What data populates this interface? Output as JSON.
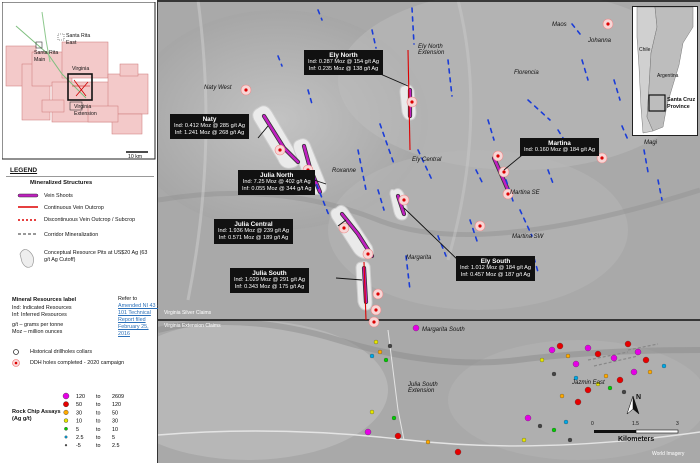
{
  "title": "",
  "locator_map": {
    "labels": [
      "Santa Rita East",
      "Santa Rita Main",
      "Virginia",
      "Virginia Extension"
    ],
    "scale_label": "10 km"
  },
  "legend": {
    "heading": "LEGEND",
    "structures_heading": "Mineralized Structures",
    "items": [
      "Vein Shoots",
      "Continuous Vein Outcrop",
      "Discontinuous Vein Outcrop / Subcrop",
      "Corridor Mineralization"
    ],
    "pit_label": "Conceptual Resource Pits at US$20 Ag (63 g/t Ag Cutoff)",
    "resources_heading": "Mineral Resources label",
    "resources_lines": [
      "Ind: Indicated Resources",
      "Inf: Inferred Resources",
      "g/t – grams per tonne",
      "Moz – million ounces"
    ],
    "refer_lines": [
      "Refer to",
      "Amended NI 43 -",
      "101 Technical",
      "Report filed",
      "February 25,",
      "2016"
    ],
    "drill_items": [
      "Historical drillholes collars",
      "DDH holes completed - 2020 campaign"
    ],
    "rock_chip_heading": "Rock Chip Assays (Ag g/t)",
    "rock_chip_bins": [
      {
        "from": "120",
        "to": "2609",
        "color": "#e600e6"
      },
      {
        "from": "50",
        "to": "120",
        "color": "#e60000"
      },
      {
        "from": "30",
        "to": "50",
        "color": "#ffaa00"
      },
      {
        "from": "10",
        "to": "30",
        "color": "#e6e600"
      },
      {
        "from": "5",
        "to": "10",
        "color": "#00cc00"
      },
      {
        "from": "2.5",
        "to": "5",
        "color": "#00a8e6"
      },
      {
        "from": "-5",
        "to": "2.5",
        "color": "#444444"
      }
    ]
  },
  "deposits": [
    {
      "name": "Ely North",
      "ind": "Ind: 0.287 Moz @ 154 g/t Ag",
      "inf": "Inf: 0.235 Moz @ 138 g/t Ag"
    },
    {
      "name": "Naty",
      "ind": "Ind: 0.412 Moz @ 285 g/t Ag",
      "inf": "Inf: 1.241 Moz @ 268 g/t Ag"
    },
    {
      "name": "Martina",
      "ind": "Ind: 0.160 Moz @ 184 g/t Ag",
      "inf": ""
    },
    {
      "name": "Julia North",
      "ind": "Ind: 7.25 Moz @ 402 g/t Ag",
      "inf": "Inf: 0.055 Moz @ 344 g/t Ag"
    },
    {
      "name": "Julia Central",
      "ind": "Ind: 1.936 Moz @ 239 g/t Ag",
      "inf": "Inf: 0.571 Moz @ 189 g/t Ag"
    },
    {
      "name": "Ely South",
      "ind": "Ind: 1.012 Moz @ 184 g/t Ag",
      "inf": "Inf: 0.457 Moz @ 187 g/t Ag"
    },
    {
      "name": "Julia South",
      "ind": "Ind: 1.029 Moz @ 291 g/t Ag",
      "inf": "Inf: 0.343 Moz @ 175 g/t Ag"
    }
  ],
  "place_labels": [
    "Naty West",
    "Ely North Extension",
    "Florencia",
    "Maos",
    "Johanna",
    "Magi",
    "Ely Central",
    "Roxanne",
    "Martina SE",
    "Martina SW",
    "Margarita",
    "Margarita South",
    "Julia South Extension",
    "Jazmin East"
  ],
  "claim_labels": [
    "Virginia Silver Claims",
    "Virginia Extension Claims"
  ],
  "inset": {
    "labels": [
      "Chile",
      "Argentina",
      "Santa Cruz Province"
    ]
  },
  "scale": {
    "ticks": [
      "0",
      "1.5",
      "3"
    ],
    "unit": "Kilometers"
  },
  "north_label": "N",
  "credit": "World Imagery"
}
